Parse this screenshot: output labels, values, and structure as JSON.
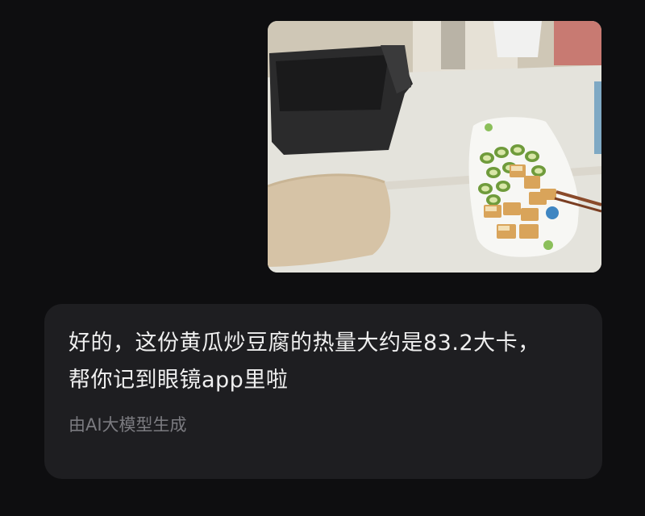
{
  "conversation": {
    "photo": {
      "description_icon": "food-photo"
    },
    "reply": {
      "line1": "好的，这份黄瓜炒豆腐的热量大约是83.2大卡，",
      "line2": "帮你记到眼镜app里啦",
      "ai_note": "由AI大模型生成"
    }
  },
  "colors": {
    "background": "#0e0e10",
    "bubble": "#1e1e21",
    "text": "#efefef",
    "muted": "#7b7b80"
  }
}
